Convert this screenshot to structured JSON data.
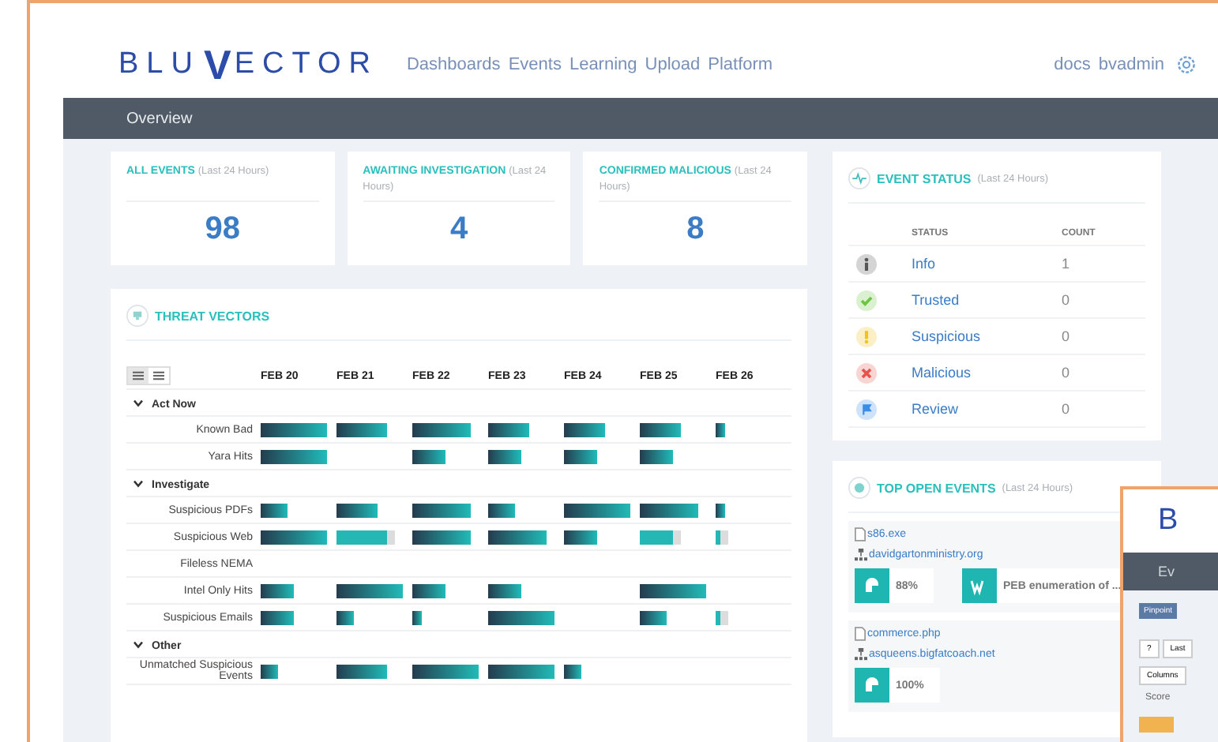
{
  "header": {
    "logo": {
      "before": "BLU",
      "mark": "V",
      "after": "ECTOR"
    },
    "nav": [
      "Dashboards",
      "Events",
      "Learning",
      "Upload",
      "Platform"
    ],
    "user_links": [
      "docs",
      "bvadmin"
    ]
  },
  "subnav": {
    "title": "Overview"
  },
  "stats": [
    {
      "title": "ALL EVENTS",
      "note": "(Last 24 Hours)",
      "value": "98"
    },
    {
      "title": "AWAITING INVESTIGATION",
      "note": "(Last 24 Hours)",
      "value": "4"
    },
    {
      "title": "CONFIRMED MALICIOUS",
      "note": "(Last 24 Hours)",
      "value": "8"
    }
  ],
  "threat_vectors": {
    "title": "THREAT VECTORS",
    "view_toggle": [
      {
        "selected": true
      },
      {
        "selected": false
      }
    ],
    "dates": [
      "FEB 20",
      "FEB 21",
      "FEB 22",
      "FEB 23",
      "FEB 24",
      "FEB 25",
      "FEB 26"
    ],
    "groups": [
      {
        "name": "Act Now",
        "expanded": true,
        "rows": [
          {
            "label": "Known Bad",
            "cells": [
              {
                "kind": "full"
              },
              {
                "kind": "wide"
              },
              {
                "kind": "large"
              },
              {
                "kind": "medium"
              },
              {
                "kind": "medium"
              },
              {
                "kind": "medium"
              },
              {
                "kind": "small"
              }
            ]
          },
          {
            "label": "Yara Hits",
            "cells": [
              {
                "kind": "full"
              },
              null,
              {
                "kind": "half"
              },
              {
                "kind": "half"
              },
              {
                "kind": "half"
              },
              {
                "kind": "half"
              },
              null
            ]
          }
        ]
      },
      {
        "name": "Investigate",
        "expanded": true,
        "rows": [
          {
            "label": "Suspicious PDFs",
            "cells": [
              {
                "kind": "third"
              },
              {
                "kind": "medium"
              },
              {
                "kind": "large"
              },
              {
                "kind": "third"
              },
              {
                "kind": "full"
              },
              {
                "kind": "large"
              },
              {
                "kind": "small"
              }
            ]
          },
          {
            "label": "Suspicious Web",
            "cells": [
              {
                "kind": "full",
                "pending": false
              },
              {
                "kind": "wide",
                "pending": true
              },
              {
                "kind": "large",
                "pending": false
              },
              {
                "kind": "large",
                "pending": false
              },
              {
                "kind": "half",
                "pending": false
              },
              {
                "kind": "half",
                "pending": true
              },
              {
                "kind": "sliver",
                "pending": true
              }
            ]
          },
          {
            "label": "Fileless NEMA",
            "cells": [
              null,
              null,
              null,
              null,
              null,
              null,
              null
            ]
          },
          {
            "label": "Intel Only Hits",
            "cells": [
              {
                "kind": "half"
              },
              {
                "kind": "full"
              },
              {
                "kind": "half"
              },
              {
                "kind": "half"
              },
              null,
              {
                "kind": "full"
              },
              null
            ]
          },
          {
            "label": "Suspicious Emails",
            "cells": [
              {
                "kind": "half",
                "pending": false
              },
              {
                "kind": "quarter",
                "pending": false
              },
              {
                "kind": "small",
                "pending": false
              },
              {
                "kind": "full",
                "pending": false
              },
              null,
              {
                "kind": "third",
                "pending": false
              },
              {
                "kind": "sliver",
                "pending": true
              }
            ]
          }
        ]
      },
      {
        "name": "Other",
        "expanded": true,
        "rows": [
          {
            "label": "Unmatched Suspicious Events",
            "cells": [
              {
                "kind": "quarter"
              },
              {
                "kind": "wide"
              },
              {
                "kind": "full"
              },
              {
                "kind": "full"
              },
              {
                "kind": "quarter"
              },
              null,
              null
            ]
          }
        ]
      }
    ]
  },
  "event_status": {
    "title": "EVENT STATUS",
    "note": "(Last 24 Hours)",
    "columns": [
      "STATUS",
      "COUNT"
    ],
    "rows": [
      {
        "kind": "info",
        "color": "#555555",
        "label": "Info",
        "count": "1"
      },
      {
        "kind": "trusted",
        "color": "#6cc644",
        "label": "Trusted",
        "count": "0"
      },
      {
        "kind": "suspicious",
        "color": "#f0c419",
        "label": "Suspicious",
        "count": "0"
      },
      {
        "kind": "malicious",
        "color": "#e5534b",
        "label": "Malicious",
        "count": "0"
      },
      {
        "kind": "review",
        "color": "#3a8ee6",
        "label": "Review",
        "count": "0"
      }
    ]
  },
  "top_open_events": {
    "title": "TOP OPEN EVENTS",
    "note": "(Last 24 Hours)",
    "events": [
      {
        "file": "s86.exe",
        "domain": "davidgartonministry.org",
        "tiles": [
          {
            "kind": "score",
            "text": "88%"
          },
          {
            "kind": "rule",
            "text": "PEB enumeration of ..."
          }
        ]
      },
      {
        "file": "commerce.php",
        "domain": "asqueens.bigfatcoach.net",
        "tiles": [
          {
            "kind": "score",
            "text": "100%"
          }
        ]
      }
    ]
  },
  "overlay_window": {
    "logo": "B",
    "tab": "Ev",
    "button": "Pinpoint",
    "help": "?",
    "time_filter": "Last",
    "columns_button": "Columns",
    "column_header": "Score"
  }
}
